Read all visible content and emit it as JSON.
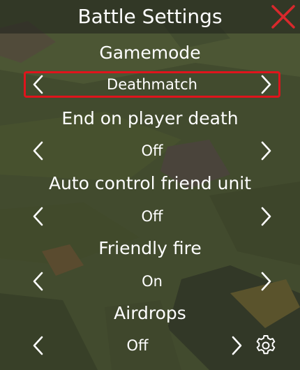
{
  "window": {
    "title": "Battle Settings"
  },
  "icons": {
    "close": "close-x-icon",
    "previous": "chevron-left-icon",
    "next": "chevron-right-icon",
    "settings": "gear-icon"
  },
  "colors": {
    "close_icon": "#d9282c",
    "highlight_border": "#e0141c",
    "text": "#ffffff"
  },
  "settings": [
    {
      "label": "Gamemode",
      "value": "Deathmatch",
      "selected": true
    },
    {
      "label": "End on player death",
      "value": "Off",
      "selected": false
    },
    {
      "label": "Auto control friend unit",
      "value": "Off",
      "selected": false
    },
    {
      "label": "Friendly fire",
      "value": "On",
      "selected": false
    },
    {
      "label": "Airdrops",
      "value": "Off",
      "selected": false,
      "has_settings_button": true
    }
  ]
}
